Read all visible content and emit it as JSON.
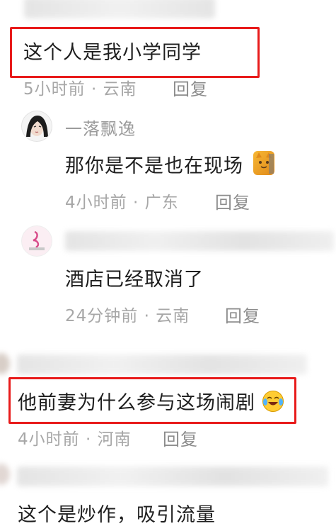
{
  "comments": [
    {
      "text": "这个人是我小学同学",
      "time": "5小时前",
      "location": "云南",
      "reply": "回复"
    },
    {
      "user": "一落飘逸",
      "text": "那你是不是也在现场",
      "time": "4小时前",
      "location": "广东",
      "reply": "回复"
    },
    {
      "text": "酒店已经取消了",
      "time": "24分钟前",
      "location": "云南",
      "reply": "回复"
    },
    {
      "text": "他前妻为什么参与这场闹剧",
      "time": "4小时前",
      "location": "河南",
      "reply": "回复"
    },
    {
      "text": "这个是炒作，吸引流量"
    }
  ],
  "separator": " · ",
  "colors": {
    "highlight": "#e81b1b",
    "meta": "#a7a7a7",
    "text": "#1e1e1e"
  }
}
